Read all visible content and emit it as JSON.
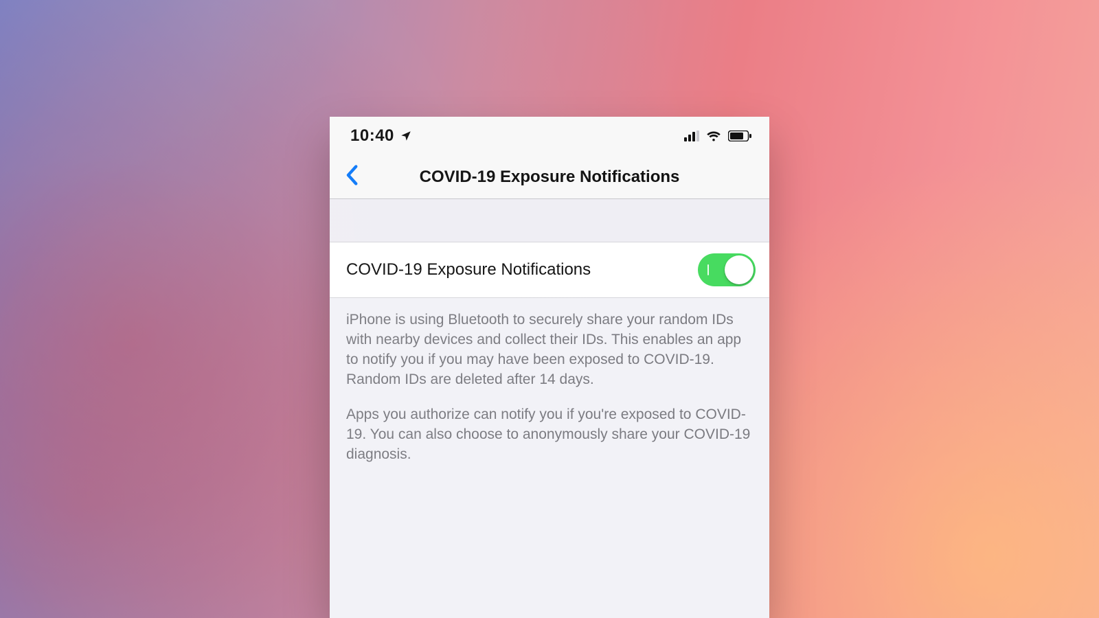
{
  "status_bar": {
    "time": "10:40"
  },
  "nav": {
    "title": "COVID-19 Exposure Notifications"
  },
  "toggle_row": {
    "label": "COVID-19 Exposure Notifications",
    "on": true,
    "on_color": "#4cd964"
  },
  "footer": {
    "p1": "iPhone is using Bluetooth to securely share your random IDs with nearby devices and collect their IDs. This enables an app to notify you if you may have been exposed to COVID-19. Random IDs are deleted after 14 days.",
    "p2": "Apps you authorize can notify you if you're exposed to COVID-19. You can also choose to anonymously share your COVID-19 diagnosis."
  }
}
